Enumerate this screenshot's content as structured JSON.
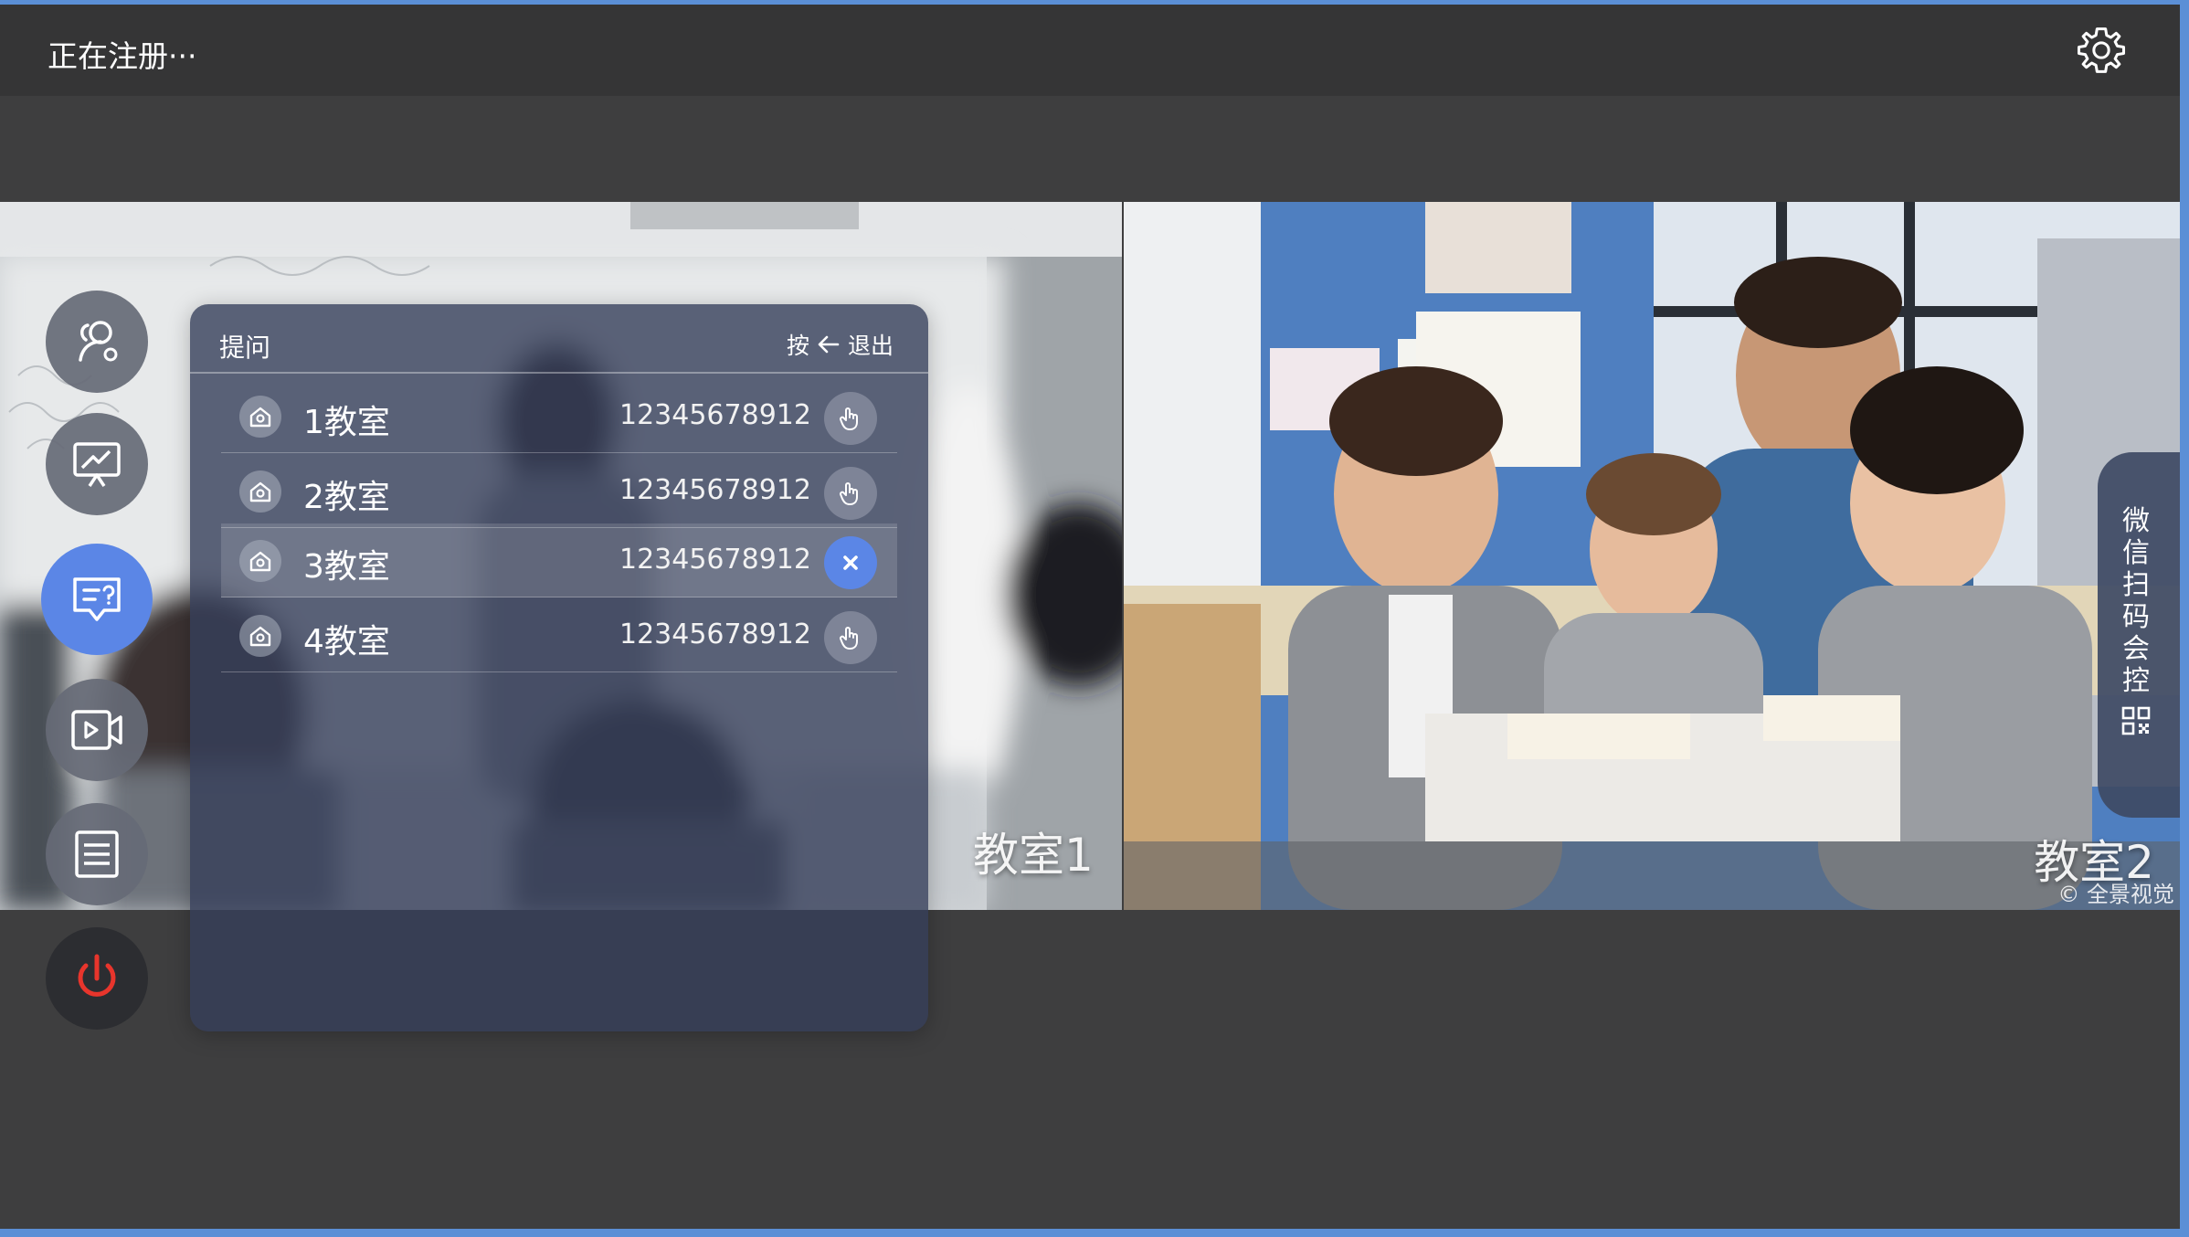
{
  "header": {
    "status": "正在注册···"
  },
  "videos": {
    "left": {
      "label": "教室1"
    },
    "right": {
      "label": "教室2",
      "watermark": "© 全景视觉"
    }
  },
  "side_tab": {
    "label": "微信扫码会控"
  },
  "question_panel": {
    "title": "提问",
    "hint_prefix": "按",
    "hint_suffix": "退出",
    "rows": [
      {
        "name": "1教室",
        "phone": "12345678912",
        "action": "hand-icon"
      },
      {
        "name": "2教室",
        "phone": "12345678912",
        "action": "hand-icon"
      },
      {
        "name": "3教室",
        "phone": "12345678912",
        "action": "close-icon"
      },
      {
        "name": "4教室",
        "phone": "12345678912",
        "action": "hand-icon"
      }
    ]
  },
  "sidebar": {
    "items": [
      {
        "icon": "user-management-icon"
      },
      {
        "icon": "screen-share-icon"
      },
      {
        "icon": "question-chat-icon"
      },
      {
        "icon": "video-camera-icon"
      },
      {
        "icon": "document-list-icon"
      },
      {
        "icon": "power-icon"
      }
    ]
  },
  "colors": {
    "accent": "#5b86e6",
    "power": "#e8352c",
    "background": "#3e3e3f"
  }
}
